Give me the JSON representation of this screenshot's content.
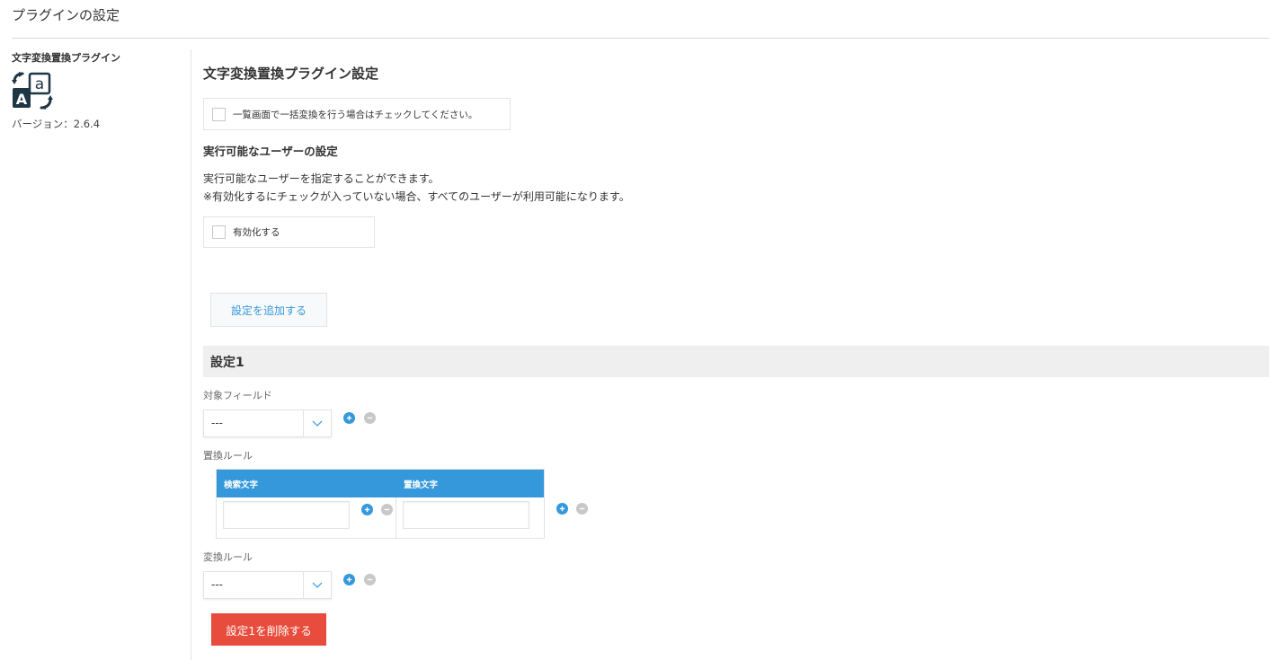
{
  "page": {
    "title": "プラグインの設定"
  },
  "sidebar": {
    "plugin_name": "文字変換置換プラグイン",
    "icon": "text-replace-icon",
    "version": "バージョン：2.6.4"
  },
  "main": {
    "heading": "文字変換置換プラグイン設定",
    "bulk_checkbox": {
      "label": "一覧画面で一括変換を行う場合はチェックしてください。",
      "checked": false
    },
    "users_section": {
      "heading": "実行可能なユーザーの設定",
      "description_line1": "実行可能なユーザーを指定することができます。",
      "description_line2": "※有効化するにチェックが入っていない場合、すべてのユーザーが利用可能になります。",
      "enable_checkbox": {
        "label": "有効化する",
        "checked": false
      }
    },
    "add_setting_label": "設定を追加する",
    "setting1": {
      "title": "設定1",
      "target_field": {
        "label": "対象フィールド",
        "value": "---"
      },
      "replace_rule": {
        "label": "置換ルール",
        "columns": [
          "検索文字",
          "置換文字"
        ],
        "rows": [
          {
            "search": "",
            "replace": ""
          }
        ]
      },
      "convert_rule": {
        "label": "変換ルール",
        "value": "---"
      },
      "delete_label": "設定1を削除する"
    }
  },
  "colors": {
    "accent": "#3498db",
    "danger": "#e74c3c",
    "icon_dark": "#1f3644",
    "minus": "#c8c8c8"
  }
}
